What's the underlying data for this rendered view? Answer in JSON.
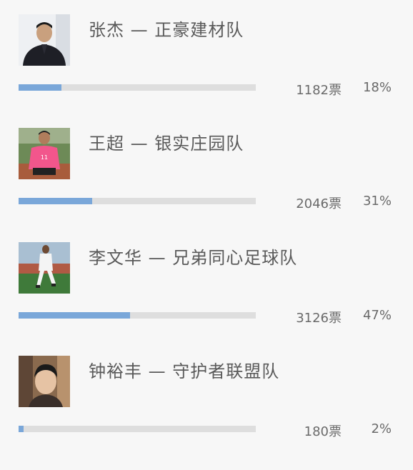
{
  "candidates": [
    {
      "name": "张杰 — 正豪建材队",
      "votes": "1182票",
      "percent": "18%",
      "share": 0.18,
      "photo": "avatar-man-black-jacket"
    },
    {
      "name": "王超 — 银实庄园队",
      "votes": "2046票",
      "percent": "31%",
      "share": 0.31,
      "photo": "avatar-man-pink-jersey"
    },
    {
      "name": "李文华 — 兄弟同心足球队",
      "votes": "3126票",
      "percent": "47%",
      "share": 0.47,
      "photo": "avatar-man-white-kit-running"
    },
    {
      "name": "钟裕丰 — 守护者联盟队",
      "votes": "180票",
      "percent": "2%",
      "share": 0.02,
      "photo": "avatar-man-selfie"
    }
  ],
  "colors": {
    "bar_fill": "#7aa7d9",
    "bar_track": "#dedede",
    "background": "#f7f7f7"
  }
}
